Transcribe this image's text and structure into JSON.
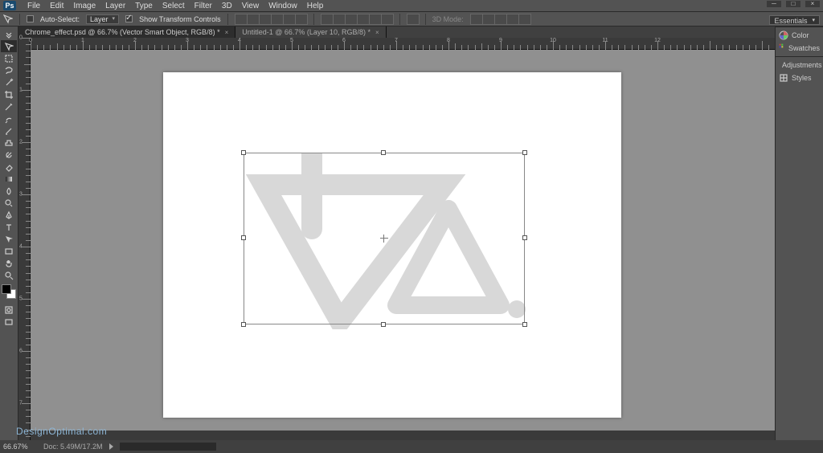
{
  "app": {
    "logo": "Ps"
  },
  "menu": [
    "File",
    "Edit",
    "Image",
    "Layer",
    "Type",
    "Select",
    "Filter",
    "3D",
    "View",
    "Window",
    "Help"
  ],
  "options": {
    "auto_select_label": "Auto-Select:",
    "auto_select_value": "Layer",
    "show_transform_label": "Show Transform Controls",
    "mode_label": "3D Mode:"
  },
  "tabs": [
    {
      "label": "Chrome_effect.psd @ 66.7% (Vector Smart Object, RGB/8) *",
      "active": true
    },
    {
      "label": "Untitled-1 @ 66.7% (Layer 10, RGB/8) *",
      "active": false
    }
  ],
  "workspace": {
    "label": "Essentials"
  },
  "panels": {
    "group1": [
      "Color",
      "Swatches"
    ],
    "group2": [
      "Adjustments",
      "Styles"
    ]
  },
  "status": {
    "zoom": "66.67%",
    "docsize": "Doc: 5.49M/17.2M"
  },
  "ruler_h_labels": [
    "0",
    "1",
    "2",
    "3",
    "4",
    "5",
    "6",
    "7",
    "8",
    "9",
    "10",
    "11",
    "12"
  ],
  "ruler_v_labels": [
    "0",
    "1",
    "2",
    "3",
    "4",
    "5",
    "6",
    "7"
  ],
  "watermark": "DesignOptimal.com"
}
